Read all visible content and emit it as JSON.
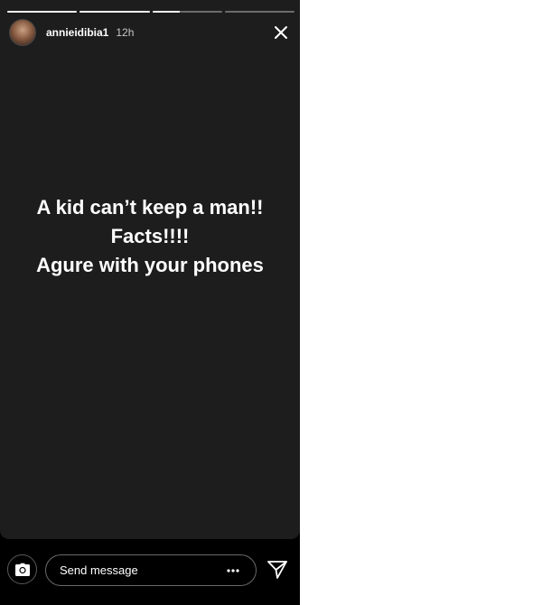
{
  "story": {
    "progress": [
      1,
      1,
      0.4,
      0
    ],
    "username": "annieidibia1",
    "timestamp": "12h",
    "background_color": "#1d1d1d",
    "text_color": "#ffffff",
    "caption_lines": [
      "A kid can’t keep a man!!",
      "Facts!!!!",
      "Agure with your phones"
    ]
  },
  "icons": {
    "close": "close-icon",
    "camera": "camera-icon",
    "more": "more-options-icon",
    "send": "send-direct-icon"
  },
  "reply": {
    "placeholder": "Send message"
  }
}
